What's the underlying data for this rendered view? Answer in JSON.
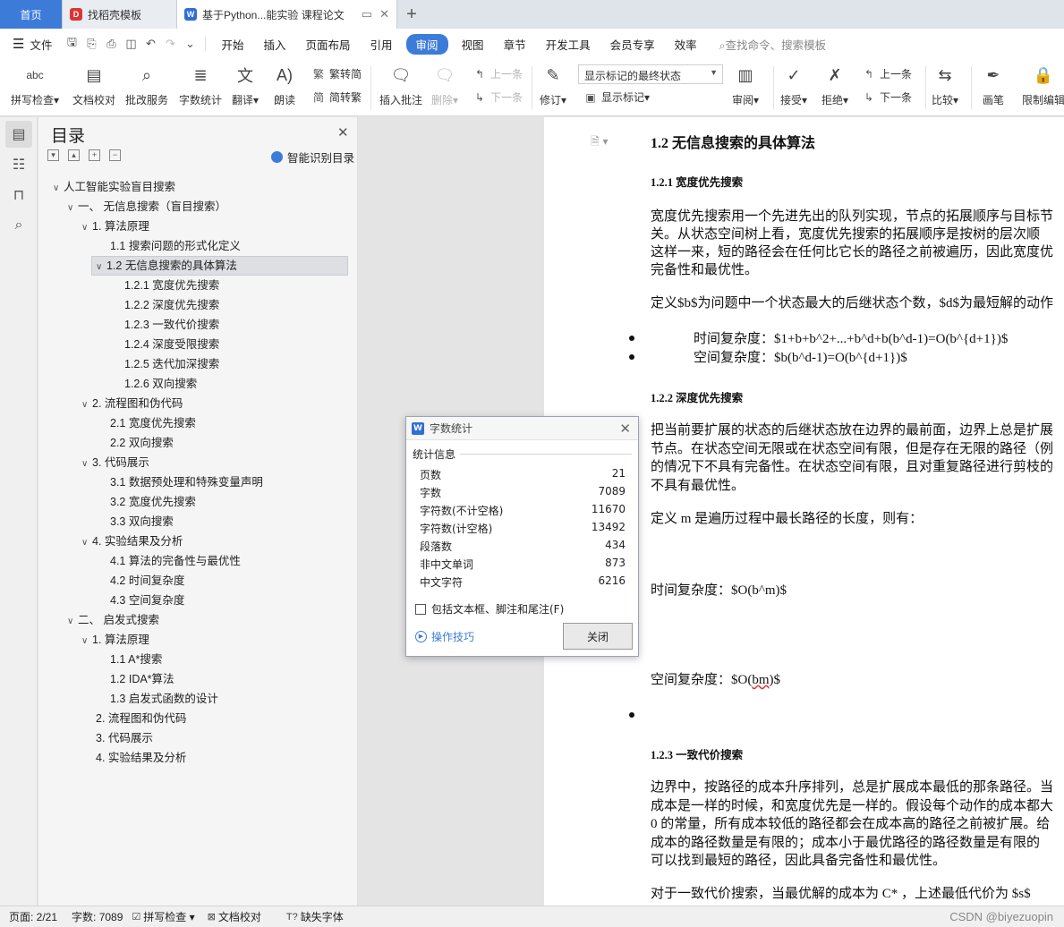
{
  "tabs": [
    {
      "label": "首页"
    },
    {
      "label": "找稻壳模板"
    },
    {
      "label": "基于Python...能实验 课程论文"
    }
  ],
  "menu": {
    "file": "文件",
    "items": [
      "开始",
      "插入",
      "页面布局",
      "引用",
      "审阅",
      "视图",
      "章节",
      "开发工具",
      "会员专享",
      "效率"
    ],
    "search_placeholder": "查找命令、搜索模板"
  },
  "ribbon": {
    "spell": "拼写检查",
    "proof": "文档校对",
    "batch": "批改服务",
    "count": "字数统计",
    "translate": "翻译",
    "read": "朗读",
    "trad": "繁转简",
    "simp": "简转繁",
    "insert_comment": "插入批注",
    "delete": "删除",
    "prev": "上一条",
    "next": "下一条",
    "track": "修订",
    "markup_select": "显示标记的最终状态",
    "show_markup": "显示标记",
    "review": "审阅",
    "accept": "接受",
    "reject": "拒绝",
    "prev2": "上一条",
    "next2": "下一条",
    "compare": "比较",
    "pen": "画笔",
    "restrict": "限制编辑"
  },
  "toc": {
    "title": "目录",
    "smart": "智能识别目录",
    "items": [
      {
        "label": "人工智能实验盲目搜索"
      },
      {
        "label": "一、 无信息搜索（盲目搜索）"
      },
      {
        "label": "1. 算法原理"
      },
      {
        "label": "1.1 搜索问题的形式化定义"
      },
      {
        "label": "1.2 无信息搜索的具体算法"
      },
      {
        "label": "1.2.1 宽度优先搜索"
      },
      {
        "label": "1.2.2 深度优先搜索"
      },
      {
        "label": "1.2.3 一致代价搜索"
      },
      {
        "label": "1.2.4 深度受限搜索"
      },
      {
        "label": "1.2.5 迭代加深搜索"
      },
      {
        "label": "1.2.6 双向搜索"
      },
      {
        "label": "2. 流程图和伪代码"
      },
      {
        "label": "2.1 宽度优先搜索"
      },
      {
        "label": "2.2 双向搜索"
      },
      {
        "label": "3. 代码展示"
      },
      {
        "label": "3.1 数据预处理和特殊变量声明"
      },
      {
        "label": "3.2 宽度优先搜索"
      },
      {
        "label": "3.3 双向搜索"
      },
      {
        "label": "4. 实验结果及分析"
      },
      {
        "label": "4.1 算法的完备性与最优性"
      },
      {
        "label": "4.2 时间复杂度"
      },
      {
        "label": "4.3 空间复杂度"
      },
      {
        "label": "二、 启发式搜索"
      },
      {
        "label": "1. 算法原理"
      },
      {
        "label": "1.1 A*搜索"
      },
      {
        "label": "1.2 IDA*算法"
      },
      {
        "label": "1.3 启发式函数的设计"
      },
      {
        "label": "2. 流程图和伪代码"
      },
      {
        "label": "3. 代码展示"
      },
      {
        "label": "4. 实验结果及分析"
      }
    ]
  },
  "doc": {
    "lines": [
      "1.2 无信息搜索的具体算法",
      "1.2.1 宽度优先搜索",
      "宽度优先搜索用一个先进先出的队列实现，节点的拓展顺序与目标节",
      "关。从状态空间树上看，宽度优先搜索的拓展顺序是按树的层次顺",
      "这样一来，短的路径会在任何比它长的路径之前被遍历，因此宽度优",
      "完备性和最优性。",
      "定义$b$为问题中一个状态最大的后继状态个数，$d$为最短解的动作",
      "时间复杂度：$1+b+b^2+...+b^d+b(b^d-1)=O(b^{d+1})$",
      "空间复杂度：$b(b^d-1)=O(b^{d+1})$",
      "1.2.2 深度优先搜索",
      "把当前要扩展的状态的后继状态放在边界的最前面，边界上总是扩展",
      "节点。在状态空间无限或在状态空间有限，但是存在无限的路径（例",
      "的情况下不具有完备性。在状态空间有限，且对重复路径进行剪枝的",
      "不具有最优性。",
      "定义 m 是遍历过程中最长路径的长度，则有：",
      "时间复杂度：$O(b^m)$",
      "空间复杂度：$O(",
      "bm",
      ")$",
      "1.2.3 一致代价搜索",
      "边界中，按路径的成本升序排列，总是扩展成本最低的那条路径。当",
      "成本是一样的时候，和宽度优先是一样的。假设每个动作的成本都大",
      "0 的常量，所有成本较低的路径都会在成本高的路径之前被扩展。给",
      "成本的路径数量是有限的；成本小于最优路径的路径数量是有限的",
      "可以找到最短的路径，因此具备完备性和最优性。",
      "对于一致代价搜索，当最优解的成本为 C* ，上述最低代价为 $s$"
    ]
  },
  "dialog": {
    "title": "字数统计",
    "group": "统计信息",
    "stats": [
      {
        "label": "页数",
        "value": "21"
      },
      {
        "label": "字数",
        "value": "7089"
      },
      {
        "label": "字符数(不计空格)",
        "value": "11670"
      },
      {
        "label": "字符数(计空格)",
        "value": "13492"
      },
      {
        "label": "段落数",
        "value": "434"
      },
      {
        "label": "非中文单词",
        "value": "873"
      },
      {
        "label": "中文字符",
        "value": "6216"
      }
    ],
    "checkbox": "包括文本框、脚注和尾注(F)",
    "tips": "操作技巧",
    "close": "关闭"
  },
  "status": {
    "page": "页面: 2/21",
    "words": "字数: 7089",
    "spell": "拼写检查",
    "proof": "文档校对",
    "missing_font": "缺失字体",
    "watermark": "CSDN @biyezuopin"
  }
}
